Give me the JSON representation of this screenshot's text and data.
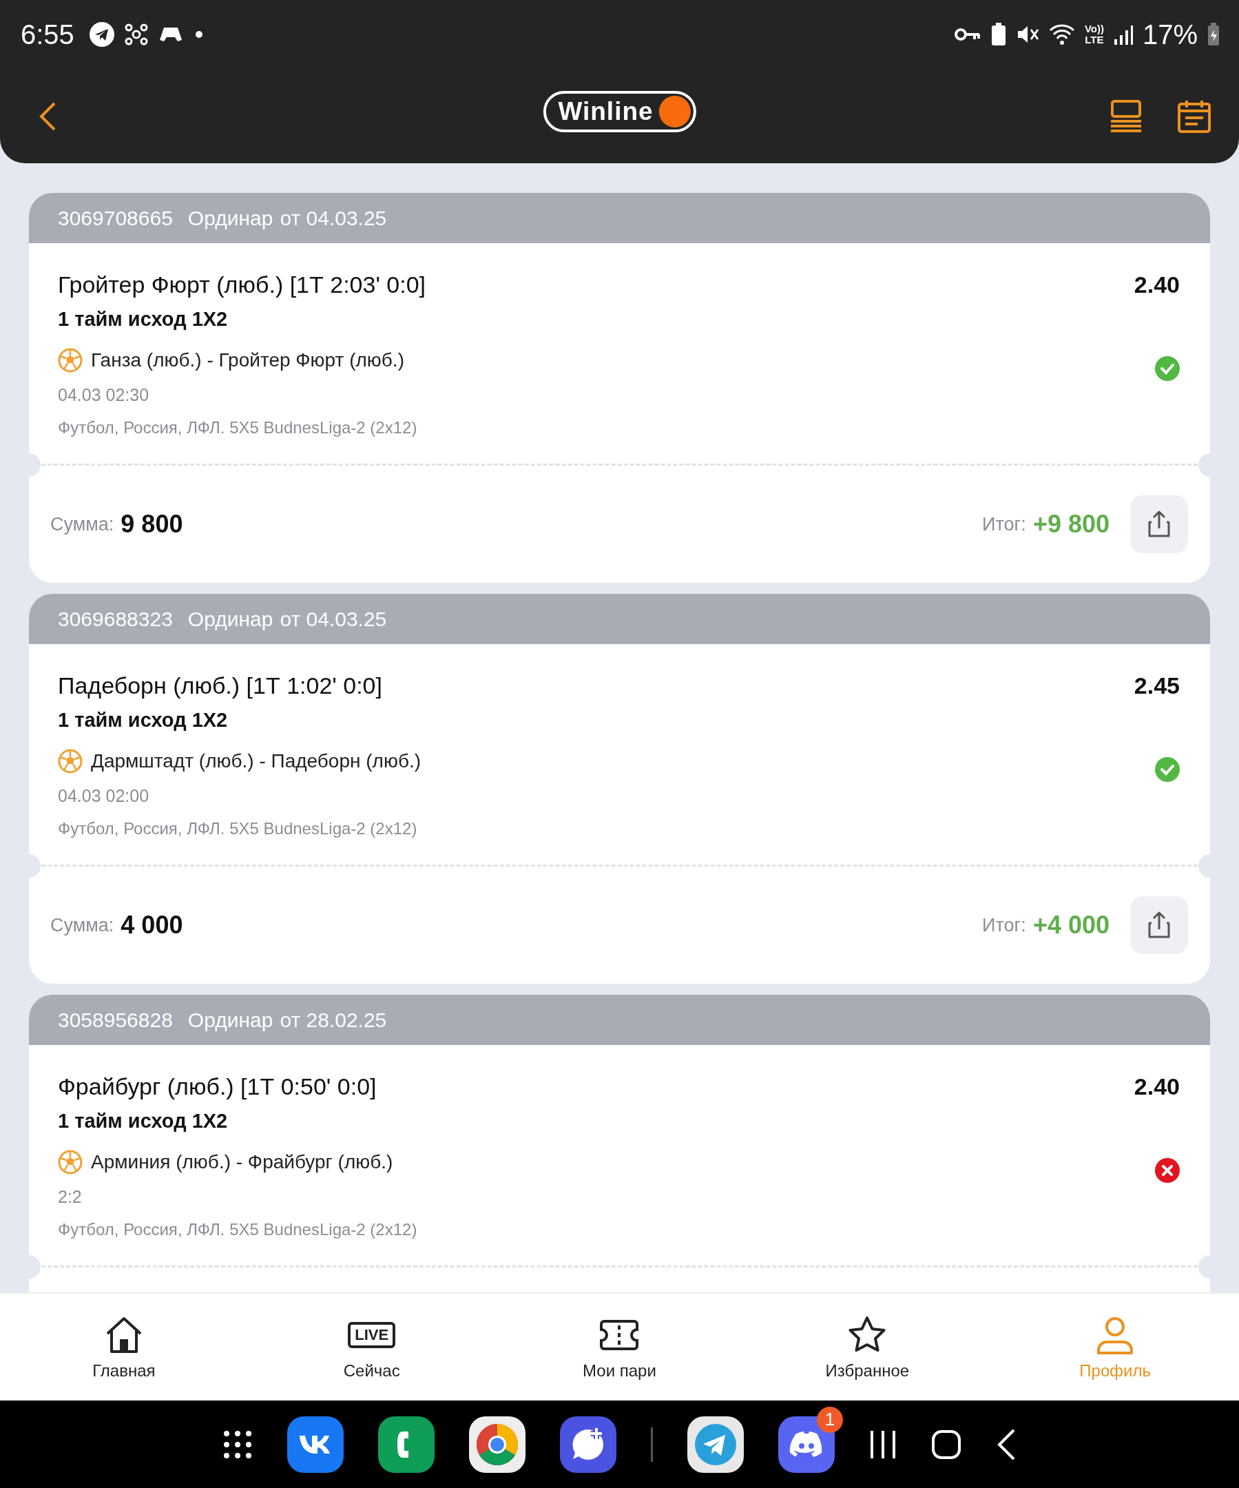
{
  "status_bar": {
    "time": "6:55",
    "network": [
      "Vo))",
      "LTE"
    ],
    "battery": "17%"
  },
  "header": {
    "logo": "Winline"
  },
  "bets": [
    {
      "number": "3069708665",
      "type": "Ординар",
      "date": "от 04.03.25",
      "event": "Гройтер Фюрт (люб.) [1Т 2:03' 0:0]",
      "odds": "2.40",
      "market": "1 тайм исход 1X2",
      "match": "Ганза (люб.) - Гройтер Фюрт (люб.)",
      "info": "04.03 02:30",
      "league": "Футбол, Россия, ЛФЛ. 5X5 BudnesLiga-2 (2x12)",
      "won": true,
      "footer": {
        "sum_label": "Сумма:",
        "sum": "9 800",
        "total_label": "Итог:",
        "total": "+9 800"
      }
    },
    {
      "number": "3069688323",
      "type": "Ординар",
      "date": "от 04.03.25",
      "event": "Падеборн (люб.) [1Т 1:02' 0:0]",
      "odds": "2.45",
      "market": "1 тайм исход 1X2",
      "match": "Дармштадт (люб.) - Падеборн (люб.)",
      "info": "04.03 02:00",
      "league": "Футбол, Россия, ЛФЛ. 5X5 BudnesLiga-2 (2x12)",
      "won": true,
      "footer": {
        "sum_label": "Сумма:",
        "sum": "4 000",
        "total_label": "Итог:",
        "total": "+4 000"
      }
    },
    {
      "number": "3058956828",
      "type": "Ординар",
      "date": "от 28.02.25",
      "event": "Фрайбург (люб.) [1Т 0:50' 0:0]",
      "odds": "2.40",
      "market": "1 тайм исход 1X2",
      "match": "Арминия (люб.) - Фрайбург (люб.)",
      "info": "2:2",
      "league": "Футбол, Россия, ЛФЛ. 5X5 BudnesLiga-2 (2x12)",
      "won": false
    }
  ],
  "bottom_nav": [
    {
      "kind": "home",
      "label": "Главная",
      "selected": false
    },
    {
      "kind": "live",
      "icon_text": "LIVE",
      "label": "Сейчас",
      "selected": false
    },
    {
      "kind": "ticket",
      "label": "Мои пари",
      "selected": false
    },
    {
      "kind": "star",
      "label": "Избранное",
      "selected": false
    },
    {
      "kind": "person",
      "label": "Профиль",
      "selected": true
    }
  ],
  "taskbar": {
    "discord_badge": "1"
  }
}
